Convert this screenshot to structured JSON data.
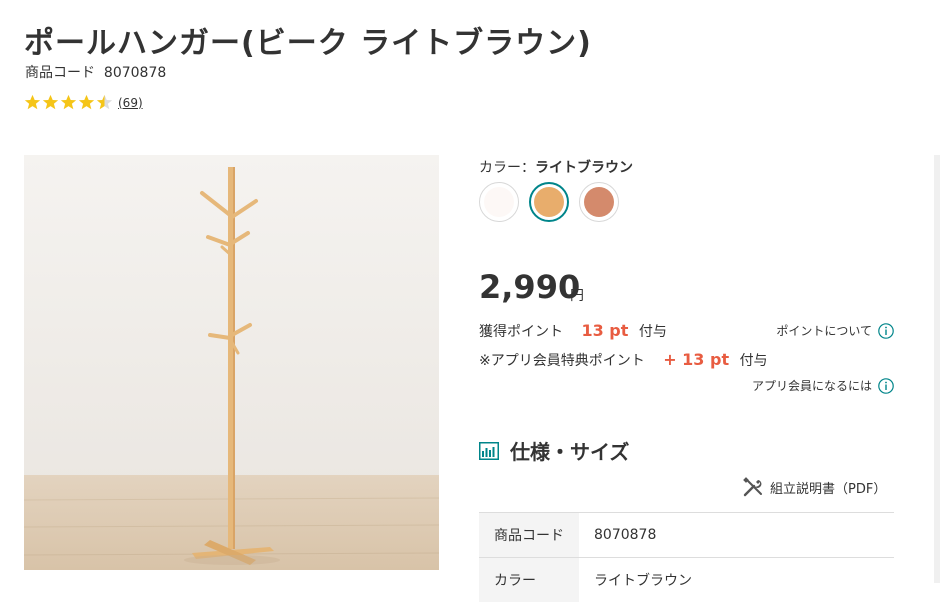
{
  "product": {
    "title": "ポールハンガー(ビーク ライトブラウン)",
    "code_label": "商品コード",
    "code_value": "8070878",
    "rating": 4.5,
    "review_count": "(69)"
  },
  "color": {
    "label_prefix": "カラー：",
    "selected": "ライトブラウン",
    "swatches": [
      {
        "name": "white",
        "hex": "#fdf8f6"
      },
      {
        "name": "light-brown",
        "hex": "#e8ad6c"
      },
      {
        "name": "brown",
        "hex": "#d48a6c"
      }
    ]
  },
  "price": {
    "value": "2,990",
    "unit": "円"
  },
  "points": {
    "earned_label": "獲得ポイント",
    "earned_value": "13 pt",
    "earned_suffix": "付与",
    "about_link": "ポイントについて",
    "app_label": "※アプリ会員特典ポイント",
    "app_value": "+ 13 pt",
    "app_suffix": "付与",
    "app_link": "アプリ会員になるには"
  },
  "specs": {
    "heading": "仕様・サイズ",
    "manual_link": "組立説明書（PDF）",
    "rows": [
      {
        "key": "商品コード",
        "value": "8070878"
      },
      {
        "key": "カラー",
        "value": "ライトブラウン"
      }
    ]
  },
  "colors": {
    "accent": "#00858a",
    "point_red": "#e85c41",
    "star": "#f5c518"
  }
}
